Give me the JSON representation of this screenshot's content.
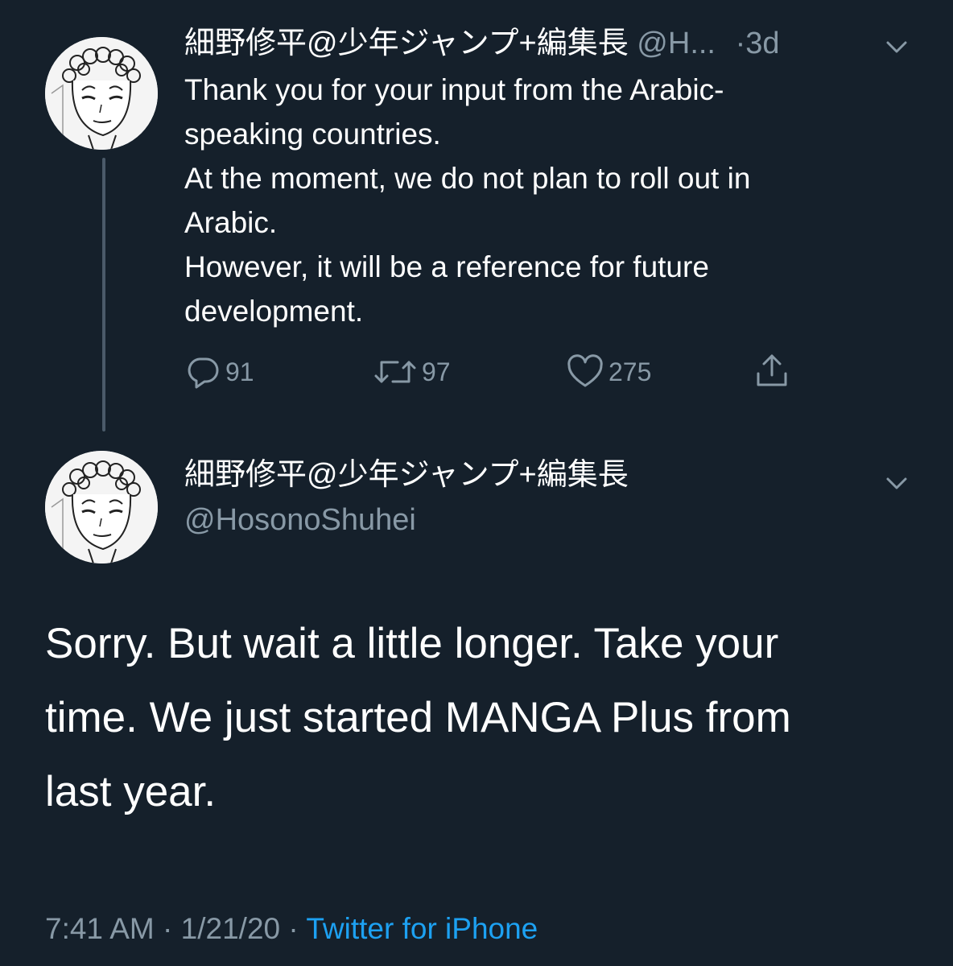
{
  "tweet1": {
    "display_name": "細野修平@少年ジャンプ+編集長",
    "handle_truncated": "@H...",
    "separator": "·",
    "time_ago": "3d",
    "text_lines": [
      "Thank you for your input from the Arabic-",
      "speaking countries.",
      "At the moment, we do not plan to roll out in",
      "Arabic.",
      "However, it will be a reference for future",
      "development."
    ],
    "reply_count": "91",
    "retweet_count": "97",
    "like_count": "275"
  },
  "tweet2": {
    "display_name": "細野修平@少年ジャンプ+編集長",
    "handle": "@HosonoShuhei",
    "text_lines": [
      "Sorry. But wait a little longer. Take your",
      "time. We just started MANGA Plus from",
      "last year."
    ],
    "time": "7:41 AM",
    "sep1": "·",
    "date": "1/21/20",
    "sep2": "·",
    "source": "Twitter for iPhone"
  },
  "icons": {
    "reply": "reply-icon",
    "retweet": "retweet-icon",
    "like": "heart-icon",
    "share": "share-icon",
    "menu": "chevron-down-icon"
  },
  "colors": {
    "background": "#15202b",
    "text": "#ffffff",
    "muted": "#8899a6",
    "link": "#1da1f2",
    "thread_line": "#4b5a69"
  }
}
